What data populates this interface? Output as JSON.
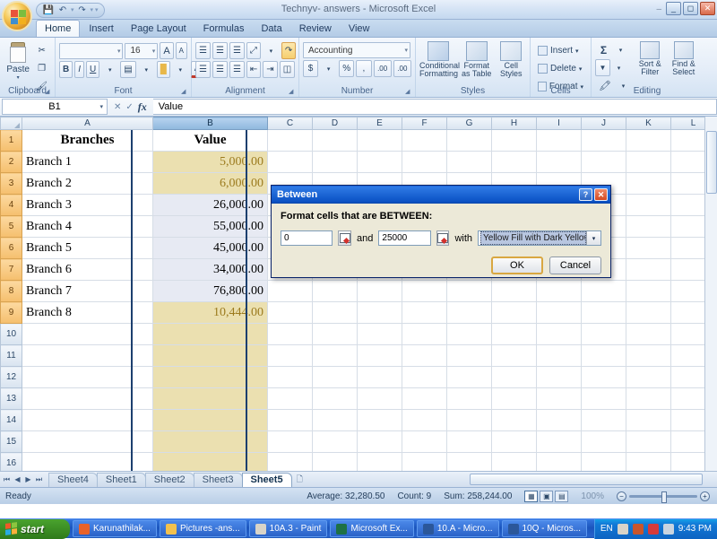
{
  "window": {
    "title": "Technyv- answers - Microsoft Excel",
    "minimize": "_",
    "restore": "&#9723;",
    "close": "&#10005;",
    "hide_ribbon": "&#8211;"
  },
  "quick_access": {
    "save": "&#128190;",
    "undo": "&#8630;",
    "undo_caret": "&#9662;",
    "redo": "&#8631;",
    "redo_caret": "&#9662;",
    "customize": "&#9662;"
  },
  "ribbon_tabs": [
    {
      "label": "Home",
      "active": true
    },
    {
      "label": "Insert",
      "active": false
    },
    {
      "label": "Page Layout",
      "active": false
    },
    {
      "label": "Formulas",
      "active": false
    },
    {
      "label": "Data",
      "active": false
    },
    {
      "label": "Review",
      "active": false
    },
    {
      "label": "View",
      "active": false
    }
  ],
  "ribbon": {
    "clipboard": {
      "label": "Clipboard",
      "paste": "Paste",
      "paste_caret": "&#9662;",
      "cut": "&#9986;",
      "copy": "&#10064;",
      "format_painter": "&#128396;",
      "dialog_launcher": "&#9698;"
    },
    "font": {
      "label": "Font",
      "font_name": "",
      "font_size": "16",
      "grow_font": "A",
      "shrink_font": "A",
      "bold": "B",
      "italic": "I",
      "underline": "U",
      "underline_caret": "&#9662;",
      "borders": "&#9636;",
      "borders_caret": "&#9662;",
      "fill_color": "&#9608;",
      "fill_caret": "&#9662;",
      "font_color": "A",
      "font_caret": "&#9662;",
      "dialog_launcher": "&#9698;"
    },
    "alignment": {
      "label": "Alignment",
      "align_top": "&#9776;",
      "align_middle": "&#9776;",
      "align_bottom": "&#9776;",
      "orientation": "&#10530;",
      "orientation_caret": "&#9662;",
      "align_left": "&#9776;",
      "align_center": "&#9776;",
      "align_right": "&#9776;",
      "decrease_indent": "&#8676;",
      "increase_indent": "&#8677;",
      "wrap_text": "&#8631;",
      "merge_center": "&#9707;",
      "merge_caret": "&#9662;",
      "dialog_launcher": "&#9698;"
    },
    "number": {
      "label": "Number",
      "format": "Accounting",
      "format_caret": "&#9662;",
      "currency": "$",
      "currency_caret": "&#9662;",
      "percent": "%",
      "comma": "&#44;",
      "increase_decimal": ".00",
      "decrease_decimal": ".00",
      "dialog_launcher": "&#9698;"
    },
    "styles": {
      "label": "Styles",
      "conditional_formatting": "Conditional\nFormatting",
      "conditional_line1": "Conditional",
      "conditional_line2": "Formatting",
      "format_as_table_line1": "Format",
      "format_as_table_line2": "as Table",
      "cell_styles_line1": "Cell",
      "cell_styles_line2": "Styles",
      "caret": "&#9662;"
    },
    "cells": {
      "label": "Cells",
      "insert": "Insert",
      "delete": "Delete",
      "format": "Format",
      "caret": "&#9662;"
    },
    "editing": {
      "label": "Editing",
      "autosum": "&#931;",
      "fill": "&#9660;",
      "clear": "&#128397;",
      "sort_filter_line1": "Sort &",
      "sort_filter_line2": "Filter",
      "find_select_line1": "Find &",
      "find_select_line2": "Select",
      "caret": "&#9662;"
    }
  },
  "formula_bar": {
    "name_box": "B1",
    "name_caret": "&#9662;",
    "cancel": "&#10005;",
    "enter": "&#10003;",
    "insert_function": "fx",
    "formula": "Value"
  },
  "sheet": {
    "columns": [
      "A",
      "B",
      "C",
      "D",
      "E",
      "F",
      "G",
      "H",
      "I",
      "J",
      "K",
      "L"
    ],
    "selected_column": "B",
    "rows": [
      {
        "num": "1",
        "a": "Branches",
        "b": "Value",
        "header": true,
        "yellow": false
      },
      {
        "num": "2",
        "a": "Branch 1",
        "b": "5,000.00",
        "header": false,
        "yellow": true
      },
      {
        "num": "3",
        "a": "Branch 2",
        "b": "6,000.00",
        "header": false,
        "yellow": true
      },
      {
        "num": "4",
        "a": "Branch 3",
        "b": "26,000.00",
        "header": false,
        "yellow": false
      },
      {
        "num": "5",
        "a": "Branch 4",
        "b": "55,000.00",
        "header": false,
        "yellow": false
      },
      {
        "num": "6",
        "a": "Branch 5",
        "b": "45,000.00",
        "header": false,
        "yellow": false
      },
      {
        "num": "7",
        "a": "Branch 6",
        "b": "34,000.00",
        "header": false,
        "yellow": false
      },
      {
        "num": "8",
        "a": "Branch 7",
        "b": "76,800.00",
        "header": false,
        "yellow": false
      },
      {
        "num": "9",
        "a": "Branch 8",
        "b": "10,444.00",
        "header": false,
        "yellow": true
      },
      {
        "num": "10",
        "a": "",
        "b": "",
        "header": false,
        "yellow": true
      },
      {
        "num": "11",
        "a": "",
        "b": "",
        "header": false,
        "yellow": true
      },
      {
        "num": "12",
        "a": "",
        "b": "",
        "header": false,
        "yellow": true
      },
      {
        "num": "13",
        "a": "",
        "b": "",
        "header": false,
        "yellow": true
      },
      {
        "num": "14",
        "a": "",
        "b": "",
        "header": false,
        "yellow": true
      },
      {
        "num": "15",
        "a": "",
        "b": "",
        "header": false,
        "yellow": true
      },
      {
        "num": "16",
        "a": "",
        "b": "",
        "header": false,
        "yellow": true
      }
    ],
    "colors": {
      "yellow_fill": "#ebe0b0",
      "dark_yellow_text": "#9c7b1e",
      "selection_band": "#e7eaf3",
      "selection_border": "#1c3f6e"
    }
  },
  "sheet_tabs": {
    "first": "&#9198;",
    "prev": "&#9664;",
    "next": "&#9654;",
    "last": "&#9197;",
    "items": [
      {
        "label": "Sheet4",
        "active": false
      },
      {
        "label": "Sheet1",
        "active": false
      },
      {
        "label": "Sheet2",
        "active": false
      },
      {
        "label": "Sheet3",
        "active": false
      },
      {
        "label": "Sheet5",
        "active": true
      }
    ],
    "insert_sheet": "&#128459;"
  },
  "status_bar": {
    "mode": "Ready",
    "average": "Average: 32,280.50",
    "count": "Count: 9",
    "sum": "Sum: 258,244.00",
    "view_normal": "&#9638;",
    "view_page_layout": "&#9635;",
    "view_page_break": "&#9636;",
    "zoom_out": "&#8722;",
    "zoom_in": "+",
    "zoom_level": "100%"
  },
  "dialog": {
    "title": "Between",
    "help_btn": "?",
    "close_btn": "&#10005;",
    "prompt": "Format cells that are BETWEEN:",
    "min_value": "0",
    "and_label": "and",
    "max_value": "25000",
    "with_label": "with",
    "format_value": "Yellow Fill with Dark Yellow Text",
    "format_caret": "&#9662;",
    "ok": "OK",
    "cancel": "Cancel"
  },
  "taskbar": {
    "start": "start",
    "items": [
      {
        "label": "Karunathilak...",
        "color": "#e8622a"
      },
      {
        "label": "Pictures -ans...",
        "color": "#f2c14e"
      },
      {
        "label": "10A.3 - Paint",
        "color": "#d9d4c8"
      },
      {
        "label": "Microsoft Ex...",
        "color": "#1e7145"
      },
      {
        "label": "10.A - Micro...",
        "color": "#2b579a"
      },
      {
        "label": "10Q - Micros...",
        "color": "#2b579a"
      }
    ],
    "language": "EN",
    "tray_icons": [
      "#c8552b",
      "#d63a3a",
      "#c9d4e0"
    ],
    "clock": "9:43 PM"
  }
}
